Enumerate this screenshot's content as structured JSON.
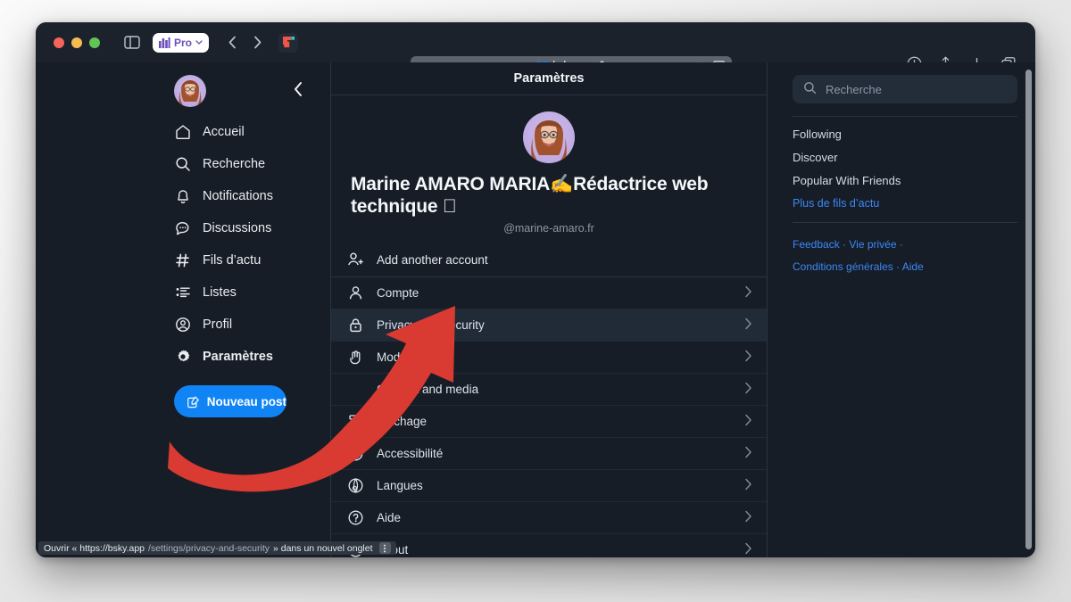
{
  "browser": {
    "profile_badge": "Pro",
    "url_domain": "bsky.app",
    "back_icon": "chevron-left-icon",
    "forward_icon": "chevron-right-icon",
    "sidebar_toggle_icon": "sidebar-toggle-icon",
    "lock_icon": "lock-icon",
    "audio_icon": "speaker-icon",
    "cast_icon": "screen-icon",
    "download_icon": "download-icon",
    "share_icon": "share-icon",
    "new_tab_icon": "plus-icon",
    "tabs_icon": "copy-tabs-icon"
  },
  "leftnav": {
    "avatar_name": "user-avatar",
    "collapse_icon": "chevron-left-icon",
    "items": [
      {
        "label": "Accueil",
        "icon": "home-icon",
        "active": false
      },
      {
        "label": "Recherche",
        "icon": "search-icon",
        "active": false
      },
      {
        "label": "Notifications",
        "icon": "bell-icon",
        "active": false
      },
      {
        "label": "Discussions",
        "icon": "chat-icon",
        "active": false
      },
      {
        "label": "Fils d’actu",
        "icon": "hash-icon",
        "active": false
      },
      {
        "label": "Listes",
        "icon": "list-icon",
        "active": false
      },
      {
        "label": "Profil",
        "icon": "profile-circle-icon",
        "active": false
      },
      {
        "label": "Paramètres",
        "icon": "gear-icon",
        "active": true
      }
    ],
    "compose_label": "Nouveau post",
    "compose_icon": "compose-icon",
    "compose_color": "#1184f5"
  },
  "center": {
    "title": "Paramètres",
    "profile": {
      "display_name": "Marine AMARO MARIA✍️Rédactrice web technique ",
      "handle": "@marine-amaro.fr",
      "avatar_name": "profile-avatar"
    },
    "add_account": {
      "label": "Add another account",
      "icon": "add-person-icon"
    },
    "rows": [
      {
        "label": "Compte",
        "icon": "person-icon",
        "highlighted": false,
        "icon_hidden": false
      },
      {
        "label": "Privacy and security",
        "icon": "lock-icon",
        "highlighted": true,
        "icon_hidden": false
      },
      {
        "label": "Modération",
        "icon": "hand-icon",
        "highlighted": false,
        "icon_hidden": false
      },
      {
        "label": "Content and media",
        "icon": "media-icon",
        "highlighted": false,
        "icon_hidden": true
      },
      {
        "label": "Affichage",
        "icon": "paint-roller-icon",
        "highlighted": false,
        "icon_hidden": false
      },
      {
        "label": "Accessibilité",
        "icon": "accessibility-icon",
        "highlighted": false,
        "icon_hidden": false
      },
      {
        "label": "Langues",
        "icon": "globe-icon",
        "highlighted": false,
        "icon_hidden": false
      },
      {
        "label": "Aide",
        "icon": "question-circle-icon",
        "highlighted": false,
        "icon_hidden": false
      },
      {
        "label": "About",
        "icon": "info-icon",
        "highlighted": false,
        "icon_hidden": false
      }
    ],
    "chevron_icon": "chevron-right-icon",
    "highlight_color": "#212a37"
  },
  "right": {
    "search_placeholder": "Recherche",
    "search_icon": "search-icon",
    "feeds": [
      "Following",
      "Discover",
      "Popular With Friends"
    ],
    "more_feeds_label": "Plus de fils d’actu",
    "footer_links": [
      "Feedback",
      "Vie privée",
      "Conditions générales",
      "Aide"
    ],
    "link_color": "#3d87f5"
  },
  "statusbar": {
    "prefix": "Ouvrir « https://bsky.app",
    "path": "/settings/privacy-and-security",
    "suffix": "» dans un nouvel onglet",
    "badge_icon": "more-vertical-icon"
  },
  "annotation": {
    "arrow_color": "#d93a32",
    "arrow_name": "red-annotation-arrow"
  }
}
